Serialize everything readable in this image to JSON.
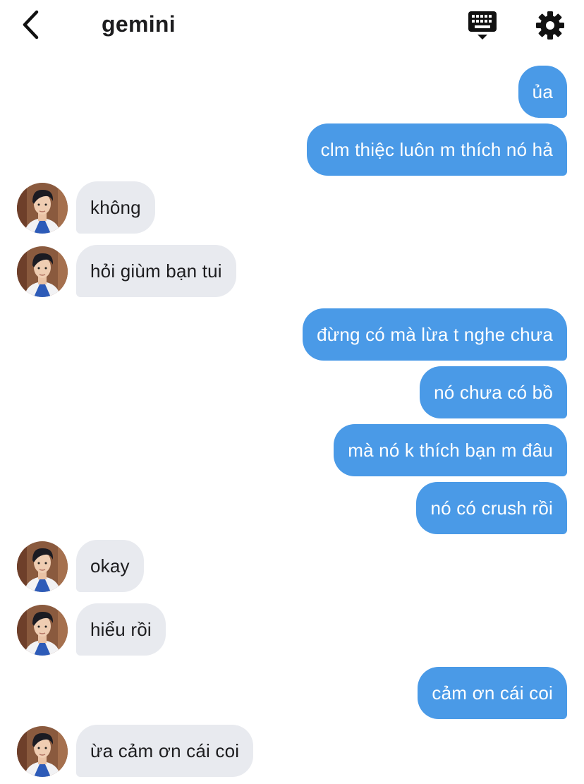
{
  "header": {
    "title": "gemini",
    "back_icon": "chevron-left-icon",
    "keyboard_icon": "keyboard-icon",
    "settings_icon": "gear-icon"
  },
  "colors": {
    "outgoing_bubble": "#4a9ae7",
    "incoming_bubble": "#e8eaef"
  },
  "messages": [
    {
      "dir": "out",
      "text": "ủa"
    },
    {
      "dir": "out",
      "text": "clm thiệc luôn m thích nó hả"
    },
    {
      "dir": "in",
      "text": "không"
    },
    {
      "dir": "in",
      "text": "hỏi giùm bạn tui"
    },
    {
      "dir": "out",
      "text": "đừng có mà lừa t nghe chưa"
    },
    {
      "dir": "out",
      "text": "nó chưa có bồ"
    },
    {
      "dir": "out",
      "text": "mà nó k thích bạn m đâu"
    },
    {
      "dir": "out",
      "text": "nó có crush rồi"
    },
    {
      "dir": "in",
      "text": "okay"
    },
    {
      "dir": "in",
      "text": "hiểu rồi"
    },
    {
      "dir": "out",
      "text": "cảm ơn cái coi"
    },
    {
      "dir": "in",
      "text": "ừa cảm ơn cái coi"
    }
  ]
}
